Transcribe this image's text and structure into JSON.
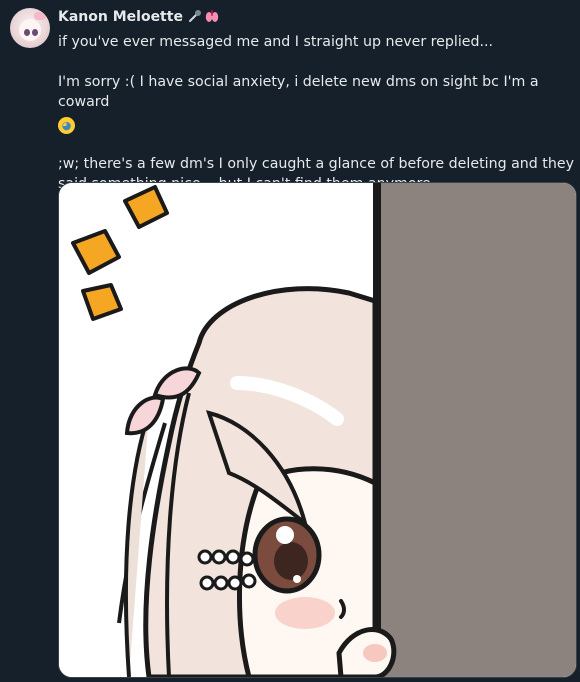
{
  "tweet": {
    "author": {
      "display_name": "Kanon Meloette",
      "name_emojis": [
        "microphone-emoji",
        "lungs-emoji"
      ]
    },
    "paragraphs": [
      "if you've ever messaged me and I straight up never replied...",
      "I'm sorry :( I have social anxiety, i delete new dms on sight bc I'm a coward",
      ";w; there's a few dm's I only caught a glance of before deleting and they said something nice... but I can't find them anymore.."
    ],
    "emoji_after_paragraph_2": "loudly-crying-face",
    "media": {
      "type": "image",
      "subject": "peeking-anime-girl-illustration"
    }
  },
  "colors": {
    "background": "#15202b",
    "text": "#e7e9ea",
    "media_border": "#38444d",
    "door": "#8c837e"
  }
}
